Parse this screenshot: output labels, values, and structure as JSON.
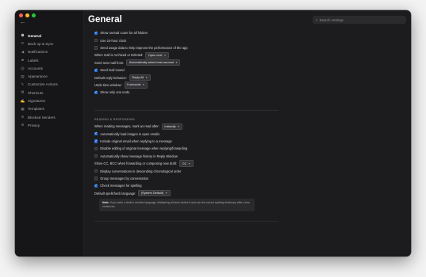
{
  "window": {
    "title": "General",
    "search_placeholder": "Search settings"
  },
  "sidebar": {
    "items": [
      {
        "label": "General",
        "icon": "gear-icon",
        "glyph": "⚙",
        "active": true
      },
      {
        "label": "Back up & Sync",
        "icon": "sync-icon",
        "glyph": "⟳",
        "active": false
      },
      {
        "label": "Notifications",
        "icon": "megaphone-icon",
        "glyph": "◀",
        "active": false
      },
      {
        "label": "Labels",
        "icon": "tag-icon",
        "glyph": "▰",
        "active": false
      },
      {
        "label": "Accounts",
        "icon": "at-icon",
        "glyph": "@",
        "active": false
      },
      {
        "label": "Appearance",
        "icon": "appearance-icon",
        "glyph": "▤",
        "active": false
      },
      {
        "label": "Customize Actions",
        "icon": "actions-icon",
        "glyph": "✎",
        "active": false
      },
      {
        "label": "Shortcuts",
        "icon": "command-icon",
        "glyph": "⌘",
        "active": false
      },
      {
        "label": "Signatures",
        "icon": "signature-icon",
        "glyph": "✍",
        "active": false
      },
      {
        "label": "Templates",
        "icon": "template-icon",
        "glyph": "▦",
        "active": false
      },
      {
        "label": "Blocked Senders",
        "icon": "block-icon",
        "glyph": "⊘",
        "active": false
      },
      {
        "label": "Privacy",
        "icon": "privacy-icon",
        "glyph": "⊛",
        "active": false
      }
    ]
  },
  "settings": {
    "show_unread_count": {
      "label": "Show unread count for all folders",
      "checked": true
    },
    "use_24h_clock": {
      "label": "Use 24-hour clock",
      "checked": false
    },
    "send_usage_data": {
      "label": "Send usage data to help improve the performance of the app",
      "checked": false
    },
    "archived_deleted": {
      "label": "When mail is Archived or Deleted:",
      "value": "Open next"
    },
    "send_new_mail_from": {
      "label": "Send new mail from:",
      "value": "Automatically select best account"
    },
    "send_mail_sound": {
      "label": "Send mail sound",
      "checked": true
    },
    "default_reply": {
      "label": "Default reply behavior:",
      "value": "Reply All"
    },
    "undo_time": {
      "label": "Undo time window:",
      "value": "5 seconds"
    },
    "show_only_one_undo": {
      "label": "Show only one undo",
      "checked": true
    }
  },
  "reading": {
    "section_title": "READING & RESPONDING",
    "mark_as_read": {
      "label": "When reading messages, mark as read after:",
      "value": "Instantly"
    },
    "auto_load_images": {
      "label": "Automatically load images in open emails",
      "checked": true
    },
    "include_original": {
      "label": "Include original email when replying to a message",
      "checked": true
    },
    "disable_editing": {
      "label": "Disable editing of original message when replying/forwarding",
      "checked": false
    },
    "show_history": {
      "label": "Automatically show message history in Reply Window",
      "checked": false
    },
    "show_cc_bcc": {
      "label": "Show CC, BCC when forwarding or composing new draft:",
      "value": "CC"
    },
    "descending_order": {
      "label": "Display conversations in descending chronological order",
      "checked": false
    },
    "group_messages": {
      "label": "Group messages by conversation",
      "checked": false
    },
    "check_spelling": {
      "label": "Check messages for spelling",
      "checked": true
    },
    "spellcheck_language": {
      "label": "Default spellcheck language:",
      "value": "(System Default)"
    },
    "note_prefix": "Note:",
    "note_text": "If you write a draft in another language, Mailspring will auto-detect it and use the correct spelling dictionary after a few sentences."
  }
}
